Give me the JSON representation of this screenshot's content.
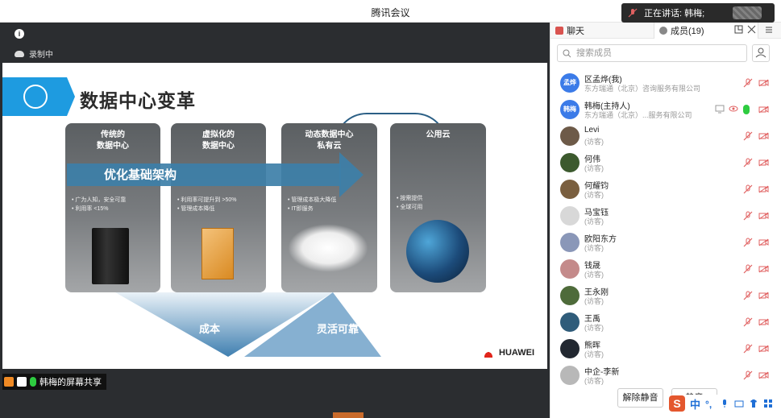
{
  "window": {
    "title": "腾讯会议",
    "min_label": "–"
  },
  "speaking": {
    "label": "正在讲话: 韩梅;"
  },
  "topbar": {
    "recording_label": "录制中"
  },
  "slide": {
    "title": "数据中心变革",
    "arrow_label": "优化基础架构",
    "cards": [
      {
        "title_line1": "传统的",
        "title_line2": "数据中心",
        "bullets": [
          "广为人知，安全可靠",
          "利用率 <15%"
        ]
      },
      {
        "title_line1": "虚拟化的",
        "title_line2": "数据中心",
        "bullets": [
          "利用率可提升到 >50%",
          "管理成本降低"
        ]
      },
      {
        "title_line1": "动态数据中心",
        "title_line2": "私有云",
        "bullets": [
          "管理成本极大降低",
          "IT即服务"
        ]
      },
      {
        "title_line1": "公用云",
        "title_line2": "",
        "bullets": [
          "按需提供",
          "全球可用"
        ]
      }
    ],
    "cost_label": "成本",
    "flex_label": "灵活可靠",
    "brand": "HUAWEI"
  },
  "share": {
    "label": "韩梅的屏幕共享"
  },
  "panel": {
    "tab_chat": "聊天",
    "tab_members": "成员(19)",
    "search_placeholder": "搜索成员",
    "members": [
      {
        "avatar_text": "孟烨",
        "avatar_color": "#3b7be8",
        "name": "区孟烨",
        "role": "(我)",
        "sub": "东方瑞通（北京）咨询服务有限公司",
        "mic_on": false
      },
      {
        "avatar_text": "韩梅",
        "avatar_color": "#3b7be8",
        "name": "韩梅",
        "role": "(主持人)",
        "sub": "东方瑞通（北京）...服务有限公司",
        "mic_on": true
      },
      {
        "avatar_text": "",
        "avatar_color": "#6d5a48",
        "name": "Levi",
        "role": "",
        "sub": "(访客)",
        "mic_on": false
      },
      {
        "avatar_text": "",
        "avatar_color": "#3c5a2e",
        "name": "何伟",
        "role": "",
        "sub": "(访客)",
        "mic_on": false
      },
      {
        "avatar_text": "",
        "avatar_color": "#7a5f3f",
        "name": "何耀钧",
        "role": "",
        "sub": "(访客)",
        "mic_on": false
      },
      {
        "avatar_text": "",
        "avatar_color": "#d8d8d8",
        "name": "马宝钰",
        "role": "",
        "sub": "(访客)",
        "mic_on": false
      },
      {
        "avatar_text": "",
        "avatar_color": "#8a97b8",
        "name": "欧阳东方",
        "role": "",
        "sub": "(访客)",
        "mic_on": false
      },
      {
        "avatar_text": "",
        "avatar_color": "#c48a8a",
        "name": "钱晟",
        "role": "",
        "sub": "(访客)",
        "mic_on": false
      },
      {
        "avatar_text": "",
        "avatar_color": "#4e6b3a",
        "name": "王永刚",
        "role": "",
        "sub": "(访客)",
        "mic_on": false
      },
      {
        "avatar_text": "",
        "avatar_color": "#2f5c7a",
        "name": "王禹",
        "role": "",
        "sub": "(访客)",
        "mic_on": false
      },
      {
        "avatar_text": "",
        "avatar_color": "#222831",
        "name": "熊晖",
        "role": "",
        "sub": "(访客)",
        "mic_on": false
      },
      {
        "avatar_text": "",
        "avatar_color": "#b8b8b8",
        "name": "中企-李新",
        "role": "",
        "sub": "(访客)",
        "mic_on": false
      }
    ],
    "unmute_label": "解除静音",
    "partial_label": "静音",
    "ime_lang": "中"
  },
  "colors": {
    "accent": "#1e9be0",
    "mic_off": "#e06060",
    "mic_on": "#2ecc40",
    "dark_bg": "#2b2d30"
  }
}
